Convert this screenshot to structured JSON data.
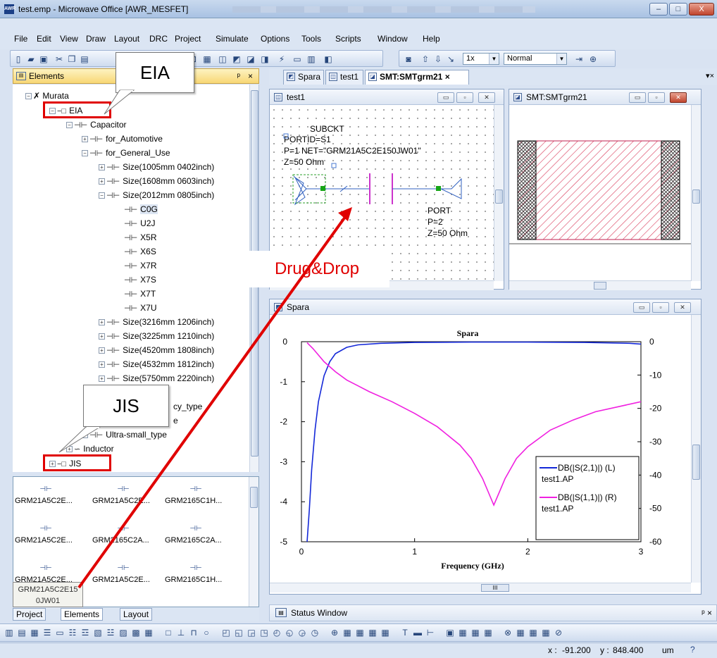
{
  "window": {
    "title": "test.emp - Microwave Office [AWR_MESFET]",
    "controls": {
      "minimize": "–",
      "maximize": "□",
      "close": "X"
    }
  },
  "menu": [
    "File",
    "Edit",
    "View",
    "Draw",
    "Layout",
    "DRC",
    "Project",
    "Simulate",
    "Options",
    "Tools",
    "Scripts",
    "Window",
    "Help"
  ],
  "toolbar": {
    "zoom_value": "1x",
    "view_mode": "Normal"
  },
  "elements_panel": {
    "title": "Elements",
    "pin": "ᵖ",
    "close": "×",
    "tree": {
      "murata": "Murata",
      "eia": "EIA",
      "capacitor": "Capacitor",
      "for_automotive": "for_Automotive",
      "for_general_use": "for_General_Use",
      "size_1005": "Size(1005mm 0402inch)",
      "size_1608": "Size(1608mm 0603inch)",
      "size_2012": "Size(2012mm 0805inch)",
      "leaves": [
        "C0G",
        "U2J",
        "X5R",
        "X6S",
        "X7R",
        "X7S",
        "X7T",
        "X7U"
      ],
      "size_3216": "Size(3216mm 1206inch)",
      "size_3225": "Size(3225mm 1210inch)",
      "size_4520": "Size(4520mm 1808inch)",
      "size_4532": "Size(4532mm 1812inch)",
      "size_5750": "Size(5750mm 2220inch)",
      "partial_freq": "cy_type",
      "partial_e": "e",
      "ultra_small": "Ultra-small_type",
      "inductor": "Inductor",
      "jis": "JIS"
    },
    "parts_grid": [
      [
        "GRM21A5C2E...",
        "GRM21A5C2E...",
        "GRM2165C1H..."
      ],
      [
        "GRM21A5C2E...",
        "GRM2165C2A...",
        "GRM2165C2A..."
      ],
      [
        "GRM21A5C2E...",
        "GRM21A5C2E...",
        "GRM2165C1H..."
      ]
    ],
    "tooltip_line1": "GRM21A5C2E15",
    "tooltip_line2": "0JW01",
    "bottom_tabs": [
      "Project",
      "Elements",
      "Layout"
    ]
  },
  "doc_tabs": [
    "Spara",
    "test1",
    "SMT:SMTgrm21"
  ],
  "schematic_window": {
    "title": "test1",
    "subckt": "SUBCKT",
    "portid": "PORTID=S1",
    "net_line": "P=1  NET=\"GRM21A5C2E150JW01\"",
    "z_line": "Z=50 Ohm",
    "port": "PORT",
    "port_p": "P=2",
    "port_z": "Z=50 Ohm"
  },
  "layout_window": {
    "title": "SMT:SMTgrm21"
  },
  "graph_window": {
    "title": "Spara"
  },
  "callouts": {
    "eia": "EIA",
    "jis": "JIS",
    "drag": "Drug&Drop"
  },
  "status_window": {
    "title": "Status Window",
    "pin": "ᵖ ×"
  },
  "statusbar": {
    "x_label": "x :",
    "x_value": "-91.200",
    "y_label": "y :",
    "y_value": "848.400",
    "unit": "um"
  },
  "colors": {
    "s21": "#1428d8",
    "s11": "#f020e0",
    "highlight": "#e00000"
  },
  "chart_data": {
    "type": "line",
    "title": "Spara",
    "xlabel": "Frequency (GHz)",
    "xlim": [
      0,
      3
    ],
    "ylim_left": [
      -5,
      0
    ],
    "ylim_right": [
      -60,
      0
    ],
    "x_ticks": [
      "0",
      "1",
      "2",
      "3"
    ],
    "y_left_ticks": [
      "0",
      "-1",
      "-2",
      "-3",
      "-4",
      "-5"
    ],
    "y_right_ticks": [
      "0",
      "-10",
      "-20",
      "-30",
      "-40",
      "-50",
      "-60"
    ],
    "series": [
      {
        "name": "DB(|S(2,1)|) (L)",
        "source": "test1.AP",
        "axis": "left",
        "x": [
          0.05,
          0.07,
          0.09,
          0.12,
          0.15,
          0.2,
          0.25,
          0.3,
          0.4,
          0.5,
          0.7,
          1.0,
          1.5,
          2.0,
          2.5,
          2.9,
          3.0
        ],
        "y": [
          -5.0,
          -4.2,
          -3.2,
          -2.2,
          -1.5,
          -0.85,
          -0.5,
          -0.3,
          -0.14,
          -0.08,
          -0.04,
          -0.02,
          -0.01,
          -0.01,
          -0.02,
          -0.04,
          -0.06
        ]
      },
      {
        "name": "DB(|S(1,1)|) (R)",
        "source": "test1.AP",
        "axis": "right",
        "x": [
          0.05,
          0.1,
          0.2,
          0.3,
          0.4,
          0.6,
          0.8,
          1.0,
          1.2,
          1.4,
          1.5,
          1.6,
          1.65,
          1.7,
          1.75,
          1.8,
          1.9,
          2.0,
          2.2,
          2.4,
          2.6,
          2.8,
          3.0
        ],
        "y": [
          -0.3,
          -2,
          -6,
          -9,
          -11.5,
          -15,
          -18,
          -21.5,
          -25.5,
          -31,
          -35,
          -41,
          -45,
          -49,
          -45,
          -41,
          -35,
          -31.5,
          -26.5,
          -23.5,
          -21,
          -19.5,
          -18
        ]
      }
    ]
  }
}
